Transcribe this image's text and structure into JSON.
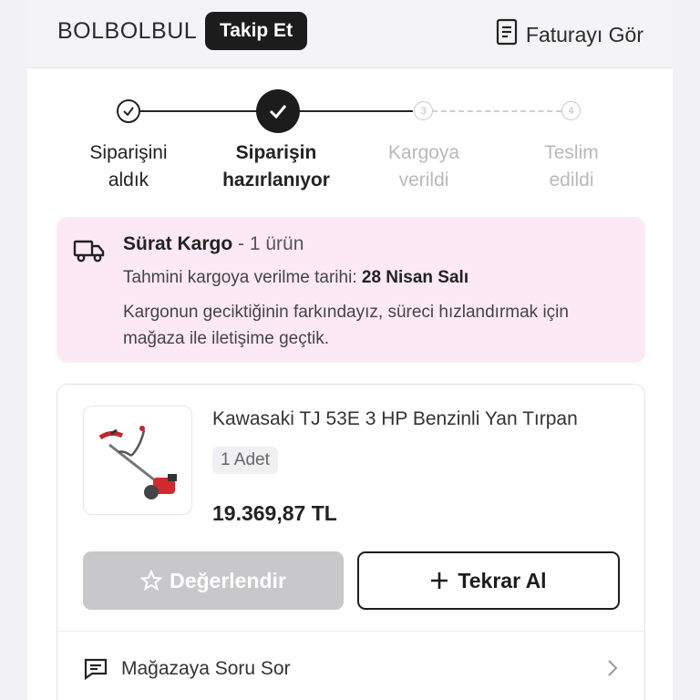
{
  "header": {
    "store_name": "BOLBOLBUL",
    "follow_label": "Takip Et",
    "invoice_label": "Faturayı Gör"
  },
  "stepper": {
    "steps": [
      {
        "line1": "Siparişini",
        "line2": "aldık",
        "state": "done"
      },
      {
        "line1": "Siparişin",
        "line2": "hazırlanıyor",
        "state": "active"
      },
      {
        "line1": "Kargoya",
        "line2": "verildi",
        "state": "future",
        "number": "3"
      },
      {
        "line1": "Teslim",
        "line2": "edildi",
        "state": "future",
        "number": "4"
      }
    ]
  },
  "shipping": {
    "carrier": "Sürat Kargo",
    "item_count": "- 1 ürün",
    "date_label": "Tahmini kargoya verilme tarihi:",
    "date_value": "28 Nisan Salı",
    "note": "Kargonun geciktiğinin farkındayız, süreci hızlandırmak için mağaza ile iletişime geçtik."
  },
  "product": {
    "title": "Kawasaki TJ 53E 3 HP Benzinli Yan Tırpan",
    "quantity": "1 Adet",
    "price": "19.369,87 TL",
    "rate_label": "Değerlendir",
    "reorder_label": "Tekrar Al"
  },
  "ask_store": {
    "label": "Mağazaya Soru Sor"
  },
  "colors": {
    "accent_dark": "#1c1c1c",
    "info_bg": "#fde9f6",
    "disabled_button": "#c8c8ca"
  }
}
